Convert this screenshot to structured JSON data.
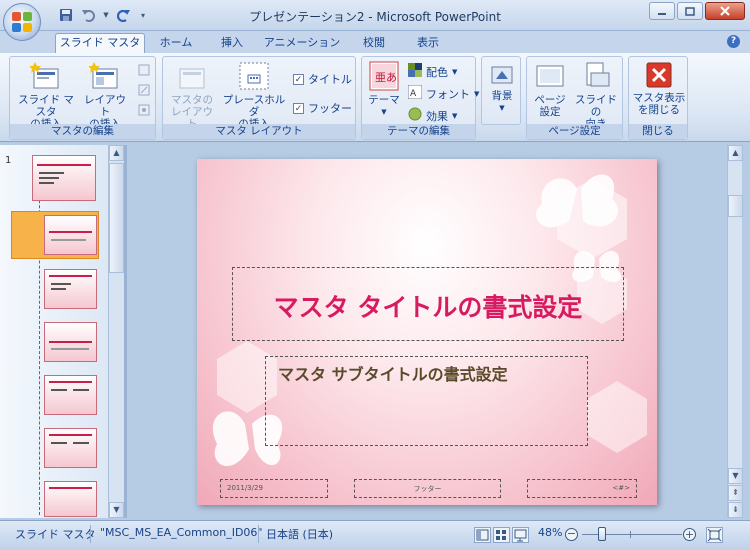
{
  "window": {
    "title": "プレゼンテーション2 - Microsoft PowerPoint"
  },
  "tabs": [
    "スライド マスタ",
    "ホーム",
    "挿入",
    "アニメーション",
    "校閲",
    "表示"
  ],
  "ribbon": {
    "master_edit": {
      "label": "マスタの編集",
      "insert_master": "スライド マスタ\nの挿入",
      "insert_layout": "レイアウト\nの挿入"
    },
    "master_layout": {
      "label": "マスタ レイアウト",
      "master_layout_btn": "マスタの\nレイアウト",
      "insert_placeholder": "プレースホルダ\nの挿入",
      "title_check": "タイトル",
      "footer_check": "フッター"
    },
    "theme_edit": {
      "label": "テーマの編集",
      "theme": "テーマ",
      "colors": "配色",
      "fonts": "フォント",
      "effects": "効果",
      "theme_icon_text": "亜あ"
    },
    "background": {
      "label": "背景"
    },
    "page_setup": {
      "label": "ページ設定",
      "page_setup_btn": "ページ\n設定",
      "orientation": "スライドの\n向き"
    },
    "close": {
      "label": "閉じる",
      "close_master": "マスタ表示\nを閉じる"
    }
  },
  "thumbnails": {
    "first_number": "1"
  },
  "slide": {
    "title": "マスタ タイトルの書式設定",
    "subtitle": "マスタ サブタイトルの書式設定",
    "date": "2011/3/29",
    "footer": "フッター",
    "page_number": "<#>"
  },
  "status": {
    "view": "スライド マスタ",
    "theme": "\"MSC_MS_EA_Common_ID06\"",
    "language": "日本語 (日本)",
    "zoom": "48%"
  },
  "colors": {
    "accent": "#d81b60",
    "ribbon_text": "#15428b"
  }
}
